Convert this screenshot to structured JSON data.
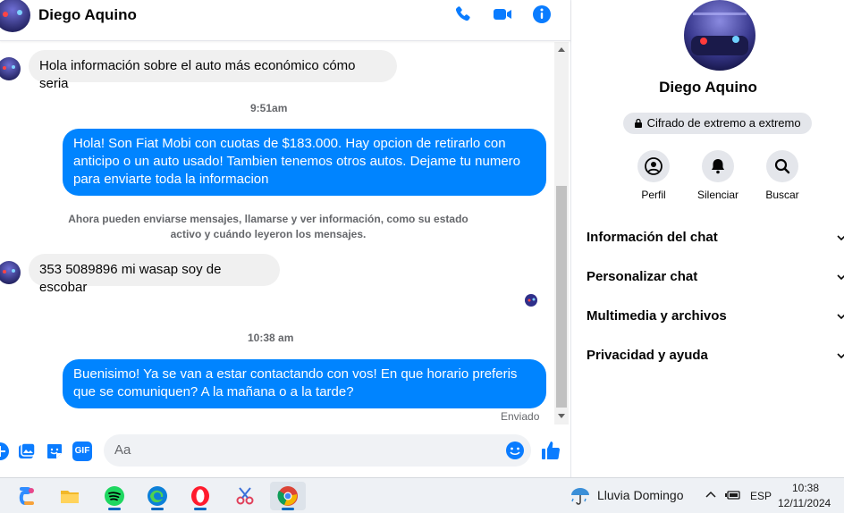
{
  "chat": {
    "contact_name": "Diego Aquino",
    "messages": [
      {
        "side": "in",
        "text": "Hola información sobre el auto más económico cómo seria"
      },
      {
        "type": "time",
        "text": "9:51am"
      },
      {
        "side": "out",
        "text": "Hola! Son Fiat Mobi con cuotas de $183.000. Hay opcion de retirarlo con anticipo o un auto usado! Tambien tenemos otros autos. Dejame tu numero para enviarte toda la informacion"
      },
      {
        "type": "system",
        "text": "Ahora pueden enviarse mensajes, llamarse y ver información, como su estado activo y cuándo leyeron los mensajes."
      },
      {
        "side": "in",
        "text": "353 5089896 mi wasap  soy de escobar"
      },
      {
        "type": "time",
        "text": "10:38 am"
      },
      {
        "side": "out",
        "text": "Buenisimo! Ya se van a estar contactando con vos! En que horario preferis que se comuniquen? A la mañana o a la tarde?"
      }
    ],
    "sent_status": "Enviado",
    "composer_placeholder": "Aa",
    "gif_label": "GIF"
  },
  "info_panel": {
    "name": "Diego Aquino",
    "encryption_label": "Cifrado de extremo a extremo",
    "actions": [
      {
        "label": "Perfil",
        "icon": "profile-icon"
      },
      {
        "label": "Silenciar",
        "icon": "bell-icon"
      },
      {
        "label": "Buscar",
        "icon": "search-icon"
      }
    ],
    "sections": [
      "Información del chat",
      "Personalizar chat",
      "Multimedia y archivos",
      "Privacidad y ayuda"
    ]
  },
  "taskbar": {
    "weather": "Lluvia Domingo",
    "language": "ESP",
    "time": "10:38",
    "date": "12/11/2024"
  },
  "colors": {
    "accent": "#0084ff",
    "icon_blue": "#0a7cff",
    "bubble_in": "#f0f0f0",
    "muted": "#65676b"
  }
}
